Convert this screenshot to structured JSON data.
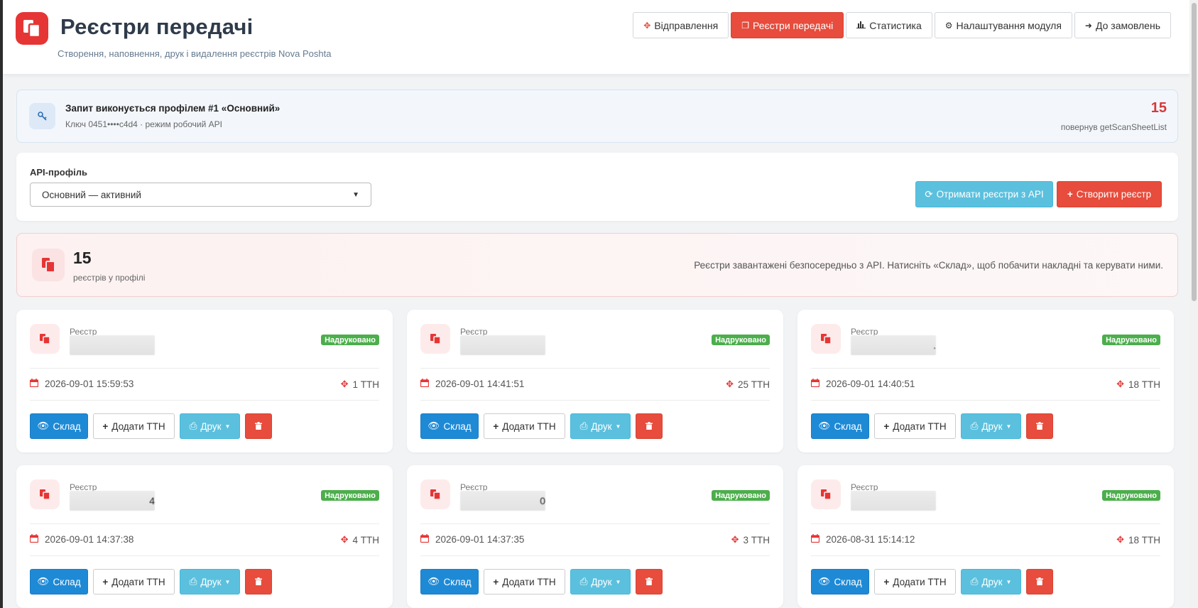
{
  "header": {
    "title": "Реєстри передачі",
    "subtitle": "Створення, наповнення, друк і видалення реєстрів Nova Poshta",
    "nav": [
      {
        "label": "Відправлення",
        "icon": "move-arrows-icon"
      },
      {
        "label": "Реєстри передачі",
        "icon": "copy-docs-icon",
        "active": true
      },
      {
        "label": "Статистика",
        "icon": "bar-chart-icon"
      },
      {
        "label": "Налаштування модуля",
        "icon": "gear-icon"
      },
      {
        "label": "До замовлень",
        "icon": "arrow-left-icon"
      }
    ]
  },
  "profile": {
    "title": "Запит виконується профілем #1 «Основний»",
    "subtitle": "Ключ 0451••••c4d4 · режим робочий API",
    "count": "15",
    "count_label": "повернув getScanSheetList"
  },
  "controls": {
    "api_label": "API-профіль",
    "selected_profile": "Основний — активний",
    "fetch_label": "Отримати реєстри з API",
    "create_label": "Створити реєстр"
  },
  "summary": {
    "count": "15",
    "count_label": "реєстрів у профілі",
    "text": "Реєстри завантажені безпосередньо з API. Натисніть «Склад», щоб побачити накладні та керувати ними."
  },
  "card_labels": {
    "register": "Реєстр",
    "status": "Надруковано",
    "sklad": "Склад",
    "add_ttn": "Додати ТТН",
    "print": "Друк"
  },
  "cards": [
    {
      "date": "2026-09-01 15:59:53",
      "ttn": "1 ТТН",
      "num_tail": ""
    },
    {
      "date": "2026-09-01 14:41:51",
      "ttn": "25 ТТН",
      "num_tail": ""
    },
    {
      "date": "2026-09-01 14:40:51",
      "ttn": "18 ТТН",
      "num_tail": "."
    },
    {
      "date": "2026-09-01 14:37:38",
      "ttn": "4 ТТН",
      "num_tail": "4"
    },
    {
      "date": "2026-09-01 14:37:35",
      "ttn": "3 ТТН",
      "num_tail": "0"
    },
    {
      "date": "2026-08-31 15:14:12",
      "ttn": "18 ТТН",
      "num_tail": ""
    }
  ],
  "colors": {
    "brand": "#e74c3c",
    "info": "#5bc0de",
    "primary": "#1e8ad6",
    "success": "#4cae4c"
  }
}
